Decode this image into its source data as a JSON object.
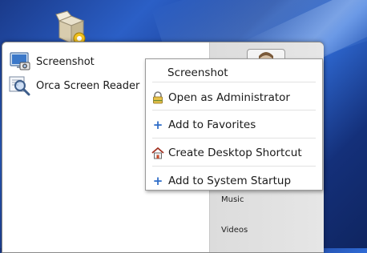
{
  "desktop": {
    "icon_name": "package-icon"
  },
  "menu": {
    "apps": [
      {
        "label": "Screenshot",
        "icon": "screenshot-icon"
      },
      {
        "label": "Orca Screen Reader",
        "icon": "screen-reader-icon"
      }
    ],
    "places": [
      {
        "label": "Music"
      },
      {
        "label": "Videos"
      }
    ]
  },
  "context_menu": {
    "title": "Screenshot",
    "items": [
      {
        "label": "Open as Administrator",
        "icon": "lock-icon"
      },
      {
        "label": "Add to Favorites",
        "icon": "plus-icon"
      },
      {
        "label": "Create Desktop Shortcut",
        "icon": "home-icon"
      },
      {
        "label": "Add to System Startup",
        "icon": "plus-icon"
      }
    ]
  },
  "colors": {
    "accent": "#2d6cc8",
    "desktop": "#1f4aa8"
  }
}
